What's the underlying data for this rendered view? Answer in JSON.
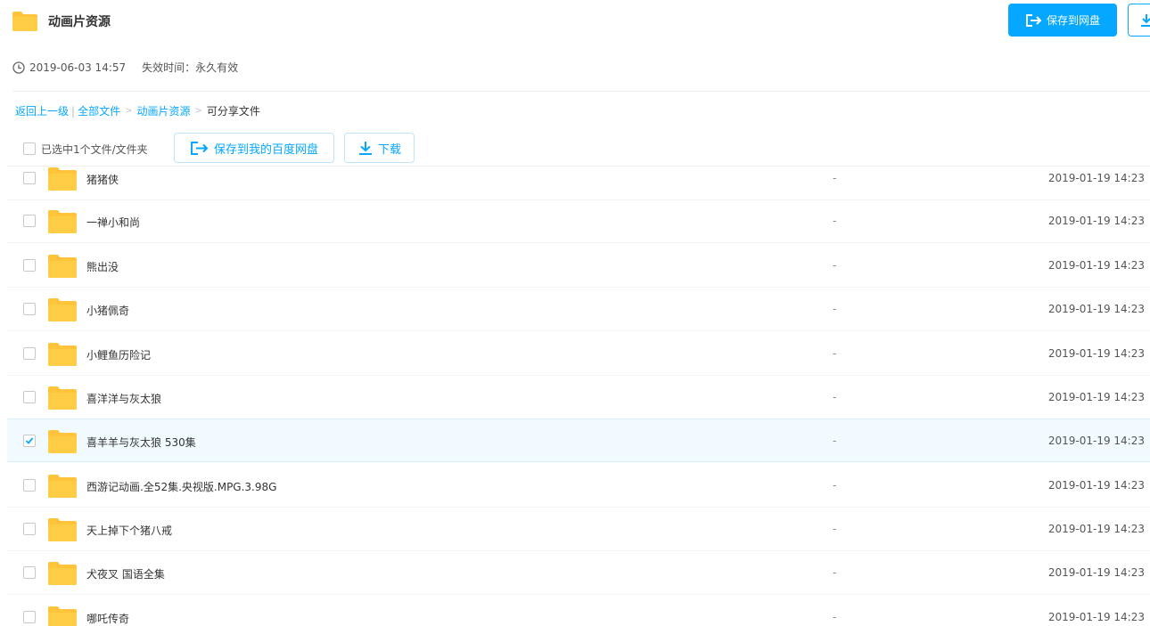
{
  "header": {
    "title": "动画片资源",
    "save_button_label": "保存到网盘",
    "accent_color": "#06a7ff",
    "folder_color": "#ffc43a"
  },
  "meta": {
    "created": "2019-06-03 14:57",
    "expiry": "失效时间：永久有效"
  },
  "breadcrumb": {
    "back": "返回上一级",
    "all_files": "全部文件",
    "parent": "动画片资源",
    "current": "可分享文件"
  },
  "toolbar": {
    "selected_text": "已选中1个文件/文件夹",
    "save_label": "保存到我的百度网盘",
    "download_label": "下载"
  },
  "files": [
    {
      "name": "猪猪侠",
      "size": "-",
      "date": "2019-01-19 14:23",
      "selected": false
    },
    {
      "name": "一禅小和尚",
      "size": "-",
      "date": "2019-01-19 14:23",
      "selected": false
    },
    {
      "name": "熊出没",
      "size": "-",
      "date": "2019-01-19 14:23",
      "selected": false
    },
    {
      "name": "小猪佩奇",
      "size": "-",
      "date": "2019-01-19 14:23",
      "selected": false
    },
    {
      "name": "小鲤鱼历险记",
      "size": "-",
      "date": "2019-01-19 14:23",
      "selected": false
    },
    {
      "name": "喜洋洋与灰太狼",
      "size": "-",
      "date": "2019-01-19 14:23",
      "selected": false
    },
    {
      "name": "喜羊羊与灰太狼 530集",
      "size": "-",
      "date": "2019-01-19 14:23",
      "selected": true
    },
    {
      "name": "西游记动画.全52集.央视版.MPG.3.98G",
      "size": "-",
      "date": "2019-01-19 14:23",
      "selected": false
    },
    {
      "name": "天上掉下个猪八戒",
      "size": "-",
      "date": "2019-01-19 14:23",
      "selected": false
    },
    {
      "name": "犬夜叉 国语全集",
      "size": "-",
      "date": "2019-01-19 14:23",
      "selected": false
    },
    {
      "name": "哪吒传奇",
      "size": "-",
      "date": "2019-01-19 14:23",
      "selected": false
    }
  ]
}
